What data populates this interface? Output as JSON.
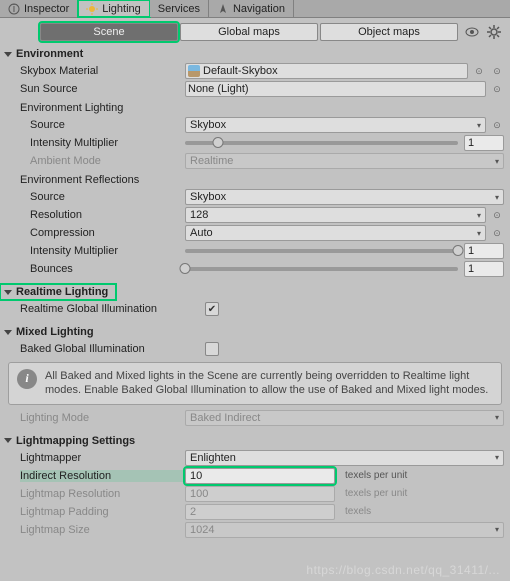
{
  "tabs": {
    "inspector": "Inspector",
    "lighting": "Lighting",
    "services": "Services",
    "navigation": "Navigation"
  },
  "modes": {
    "scene": "Scene",
    "global_maps": "Global maps",
    "object_maps": "Object maps"
  },
  "environment": {
    "title": "Environment",
    "skybox_material_label": "Skybox Material",
    "skybox_material_value": "Default-Skybox",
    "sun_source_label": "Sun Source",
    "sun_source_value": "None (Light)",
    "env_lighting_title": "Environment Lighting",
    "source_label": "Source",
    "source_value": "Skybox",
    "intensity_multiplier_label": "Intensity Multiplier",
    "intensity_multiplier_value": "1",
    "ambient_mode_label": "Ambient Mode",
    "ambient_mode_value": "Realtime",
    "env_reflections_title": "Environment Reflections",
    "refl_source_label": "Source",
    "refl_source_value": "Skybox",
    "resolution_label": "Resolution",
    "resolution_value": "128",
    "compression_label": "Compression",
    "compression_value": "Auto",
    "refl_intensity_label": "Intensity Multiplier",
    "refl_intensity_value": "1",
    "bounces_label": "Bounces",
    "bounces_value": "1"
  },
  "realtime": {
    "title": "Realtime Lighting",
    "rgi_label": "Realtime Global Illumination",
    "rgi_checked": true
  },
  "mixed": {
    "title": "Mixed Lighting",
    "bgi_label": "Baked Global Illumination",
    "bgi_checked": false,
    "help": "All Baked and Mixed lights in the Scene are currently being overridden to Realtime light modes. Enable Baked Global Illumination to allow the use of Baked and Mixed light modes.",
    "lighting_mode_label": "Lighting Mode",
    "lighting_mode_value": "Baked Indirect"
  },
  "lightmap": {
    "title": "Lightmapping Settings",
    "lightmapper_label": "Lightmapper",
    "lightmapper_value": "Enlighten",
    "indirect_res_label": "Indirect Resolution",
    "indirect_res_value": "10",
    "indirect_res_suffix": "texels per unit",
    "lightmap_res_label": "Lightmap Resolution",
    "lightmap_res_value": "100",
    "lightmap_res_suffix": "texels per unit",
    "padding_label": "Lightmap Padding",
    "padding_value": "2",
    "padding_suffix": "texels",
    "size_label": "Lightmap Size",
    "size_value": "1024"
  },
  "watermark": "https://blog.csdn.net/qq_31411/..."
}
